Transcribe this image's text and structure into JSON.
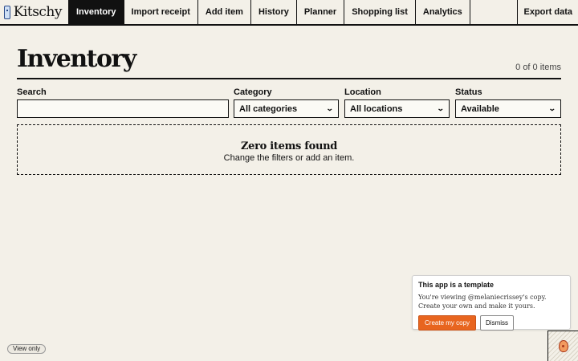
{
  "app": {
    "name": "Kitschy"
  },
  "nav": {
    "items": [
      {
        "label": "Inventory",
        "active": true
      },
      {
        "label": "Import receipt"
      },
      {
        "label": "Add item"
      },
      {
        "label": "History"
      },
      {
        "label": "Planner"
      },
      {
        "label": "Shopping list"
      },
      {
        "label": "Analytics"
      }
    ],
    "export_label": "Export data"
  },
  "page": {
    "title": "Inventory",
    "count": "0 of 0 items"
  },
  "filters": {
    "search": {
      "label": "Search",
      "value": ""
    },
    "category": {
      "label": "Category",
      "value": "All categories"
    },
    "location": {
      "label": "Location",
      "value": "All locations"
    },
    "status": {
      "label": "Status",
      "value": "Available"
    }
  },
  "empty_state": {
    "title": "Zero items found",
    "subtitle": "Change the filters or add an item."
  },
  "template_card": {
    "title": "This app is a template",
    "text": "You're viewing @melaniecrissey's copy. Create your own and make it yours.",
    "primary_label": "Create my copy",
    "secondary_label": "Dismiss"
  },
  "view_only_label": "View only",
  "colors": {
    "accent": "#e8651f",
    "ink": "#111111",
    "background": "#f3f0e8"
  }
}
